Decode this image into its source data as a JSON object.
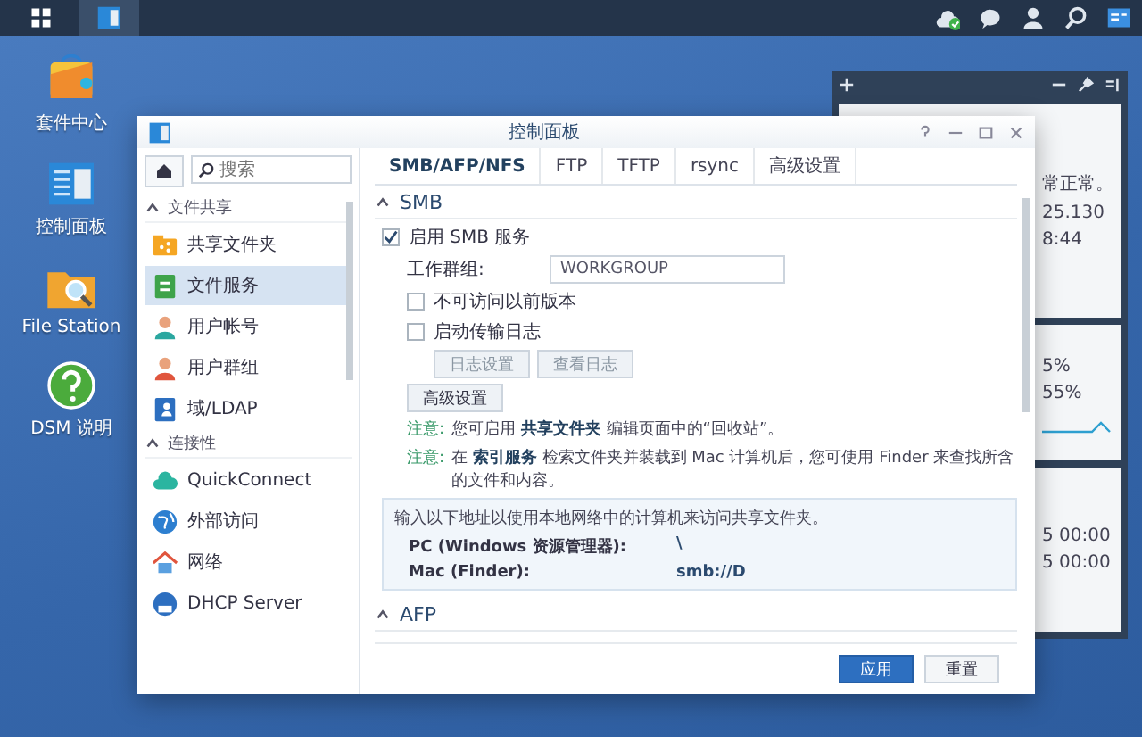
{
  "taskbar": {
    "items": [
      {
        "kind": "main-menu",
        "selected": false
      },
      {
        "kind": "control-panel",
        "selected": true
      }
    ],
    "tray": [
      {
        "kind": "cloud-check"
      },
      {
        "kind": "chat"
      },
      {
        "kind": "user"
      },
      {
        "kind": "search"
      },
      {
        "kind": "widgets"
      }
    ]
  },
  "desktop_icons": [
    {
      "label": "套件中心",
      "kind": "package"
    },
    {
      "label": "控制面板",
      "kind": "control-panel"
    },
    {
      "label": "File Station",
      "kind": "folder-search"
    },
    {
      "label": "DSM 说明",
      "kind": "help"
    }
  ],
  "widget_panel": {
    "status_text": "常正常。",
    "status_lines": [
      "25.130",
      "8:44"
    ],
    "meters": [
      "5%",
      "55%"
    ],
    "times": [
      "5 00:00",
      "5 00:00"
    ]
  },
  "window": {
    "title": "控制面板",
    "sidebar": {
      "search": {
        "placeholder": "搜索"
      },
      "groups": [
        {
          "label": "文件共享",
          "expanded": true,
          "items": [
            {
              "label": "共享文件夹",
              "kind": "shared-folder",
              "selected": false
            },
            {
              "label": "文件服务",
              "kind": "file-services",
              "selected": true
            },
            {
              "label": "用户帐号",
              "kind": "user",
              "selected": false
            },
            {
              "label": "用户群组",
              "kind": "group",
              "selected": false
            },
            {
              "label": "域/LDAP",
              "kind": "domain",
              "selected": false
            }
          ]
        },
        {
          "label": "连接性",
          "expanded": true,
          "items": [
            {
              "label": "QuickConnect",
              "kind": "cloud",
              "selected": false
            },
            {
              "label": "外部访问",
              "kind": "globe",
              "selected": false
            },
            {
              "label": "网络",
              "kind": "house",
              "selected": false
            },
            {
              "label": "DHCP Server",
              "kind": "dhcp",
              "selected": false
            }
          ]
        }
      ]
    },
    "tabs": [
      {
        "label": "SMB/AFP/NFS",
        "selected": true
      },
      {
        "label": "FTP",
        "selected": false
      },
      {
        "label": "TFTP",
        "selected": false
      },
      {
        "label": "rsync",
        "selected": false
      },
      {
        "label": "高级设置",
        "selected": false
      }
    ],
    "smb": {
      "title": "SMB",
      "expanded": true,
      "enable": {
        "label": "启用 SMB 服务",
        "checked": true
      },
      "workgroup": {
        "label": "工作群组:",
        "value": "WORKGROUP"
      },
      "options": [
        {
          "label": "不可访问以前版本",
          "checked": false
        },
        {
          "label": "启动传输日志",
          "checked": false
        }
      ],
      "log_buttons": [
        {
          "label": "日志设置",
          "disabled": true
        },
        {
          "label": "查看日志",
          "disabled": true
        }
      ],
      "advanced_button": "高级设置",
      "notes": [
        {
          "label": "注意:",
          "text": "您可启用 **共享文件夹** 编辑页面中的“回收站”。"
        },
        {
          "label": "注意:",
          "text": "在 **索引服务** 检索文件夹并装载到 Mac 计算机后，您可使用 Finder 来查找所含的文件和内容。"
        }
      ],
      "address_box": {
        "intro": "输入以下地址以使用本地网络中的计算机来访问共享文件夹。",
        "rows": [
          {
            "label": "PC (Windows 资源管理器):",
            "value": "\\"
          },
          {
            "label": "Mac (Finder):",
            "value": "smb://D"
          }
        ]
      }
    },
    "afp": {
      "title": "AFP",
      "expanded": true
    },
    "footer_buttons": [
      {
        "label": "应用",
        "kind": "primary"
      },
      {
        "label": "重置",
        "kind": "secondary"
      }
    ]
  }
}
